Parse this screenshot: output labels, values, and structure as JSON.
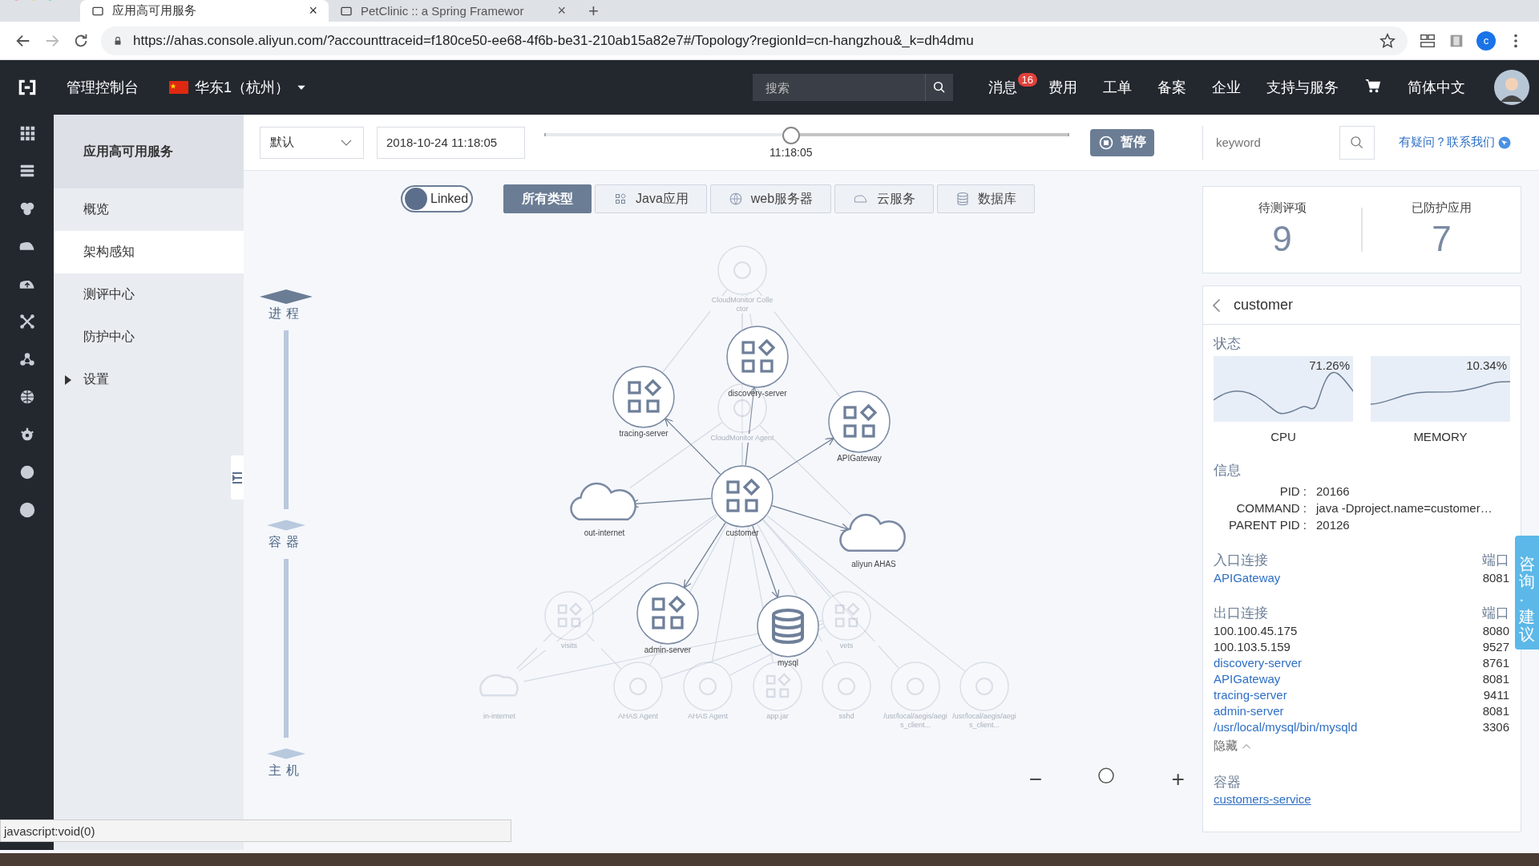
{
  "browser": {
    "tabs": [
      {
        "title": "应用高可用服务",
        "selected": true,
        "close": "×"
      },
      {
        "title": "PetClinic :: a Spring Framewor",
        "selected": false,
        "close": "×"
      }
    ],
    "new_tab": "+",
    "url": "https://ahas.console.aliyun.com/?accounttraceid=f180ce50-ee68-4f6b-be31-210ab15a82e7#/Topology?regionId=cn-hangzhou&_k=dh4dmu",
    "profile": "c"
  },
  "header": {
    "console": "管理控制台",
    "region": "华东1（杭州）",
    "search_placeholder": "搜索",
    "nav": [
      {
        "label": "消息",
        "badge": "16"
      },
      {
        "label": "费用"
      },
      {
        "label": "工单"
      },
      {
        "label": "备案"
      },
      {
        "label": "企业"
      },
      {
        "label": "支持与服务"
      }
    ],
    "language": "简体中文"
  },
  "sidebar": {
    "title": "应用高可用服务",
    "items": [
      {
        "label": "概览",
        "selected": false,
        "kind": "link"
      },
      {
        "label": "架构感知",
        "selected": true,
        "kind": "link"
      },
      {
        "label": "测评中心",
        "selected": false,
        "kind": "link"
      },
      {
        "label": "防护中心",
        "selected": false,
        "kind": "link"
      },
      {
        "label": "设置",
        "selected": false,
        "kind": "group"
      }
    ]
  },
  "toolbar": {
    "view": "默认",
    "time": "2018-10-24 11:18:05",
    "timeline": {
      "level": 0.47,
      "label": "11:18:05"
    },
    "pause": "暂停",
    "keyword_placeholder": "keyword",
    "help": "有疑问？联系我们"
  },
  "layers": [
    "进程",
    "容器",
    "主机"
  ],
  "linked": {
    "label": "Linked",
    "on": true
  },
  "type_filters": [
    {
      "label": "所有类型",
      "selected": true,
      "kind": "all"
    },
    {
      "label": "Java应用",
      "selected": false,
      "kind": "app"
    },
    {
      "label": "web服务器",
      "selected": false,
      "kind": "web"
    },
    {
      "label": "云服务",
      "selected": false,
      "kind": "cloud"
    },
    {
      "label": "数据库",
      "selected": false,
      "kind": "db"
    }
  ],
  "topology": {
    "nodes": [
      {
        "label": "CloudMonitor Collector",
        "kind": "agent",
        "faded": true
      },
      {
        "label": "discovery-server",
        "kind": "app",
        "faded": false
      },
      {
        "label": "tracing-server",
        "kind": "app",
        "faded": false
      },
      {
        "label": "CloudMonitor Agent",
        "kind": "agent",
        "faded": true
      },
      {
        "label": "APIGateway",
        "kind": "app",
        "faded": false
      },
      {
        "label": "customer",
        "kind": "app",
        "faded": false
      },
      {
        "label": "out-internet",
        "kind": "cloud",
        "faded": false
      },
      {
        "label": "aliyun AHAS",
        "kind": "cloud",
        "faded": false
      },
      {
        "label": "admin-server",
        "kind": "app",
        "faded": false
      },
      {
        "label": "visits",
        "kind": "app",
        "faded": true
      },
      {
        "label": "vets",
        "kind": "app",
        "faded": true
      },
      {
        "label": "mysql",
        "kind": "db",
        "faded": false
      },
      {
        "label": "in-internet",
        "kind": "cloud",
        "faded": true
      },
      {
        "label": "AHAS Agent",
        "kind": "agent",
        "faded": true
      },
      {
        "label": "AHAS Agent",
        "kind": "agent",
        "faded": true
      },
      {
        "label": "app.jar",
        "kind": "app",
        "faded": true
      },
      {
        "label": "sshd",
        "kind": "agent",
        "faded": true
      },
      {
        "label": "/usr/local/aegis/aegis_client...",
        "kind": "agent",
        "faded": true
      },
      {
        "label": "/usr/local/aegis/aegis_client...",
        "kind": "agent",
        "faded": true
      }
    ],
    "zoom": {
      "minus": "−",
      "plus": "+"
    }
  },
  "stats": [
    {
      "label": "待测评项",
      "value": "9"
    },
    {
      "label": "已防护应用",
      "value": "7"
    }
  ],
  "detail": {
    "title": "customer",
    "status_heading": "状态",
    "metrics": [
      {
        "name": "CPU",
        "reading": "71.26%"
      },
      {
        "name": "MEMORY",
        "reading": "10.34%"
      }
    ],
    "info_heading": "信息",
    "info": [
      {
        "key": "PID :",
        "value": "20166"
      },
      {
        "key": "COMMAND :",
        "value": "java -Dproject.name=customer…"
      },
      {
        "key": "PARENT PID :",
        "value": "20126"
      }
    ],
    "inbound": {
      "heading": "入口连接",
      "port_heading": "端口",
      "rows": [
        {
          "target": "APIGateway",
          "port": "8081",
          "kind": "link"
        }
      ]
    },
    "outbound": {
      "heading": "出口连接",
      "port_heading": "端口",
      "rows": [
        {
          "target": "100.100.45.175",
          "port": "8080",
          "kind": "plain"
        },
        {
          "target": "100.103.5.159",
          "port": "9527",
          "kind": "plain"
        },
        {
          "target": "discovery-server",
          "port": "8761",
          "kind": "link"
        },
        {
          "target": "APIGateway",
          "port": "8081",
          "kind": "link"
        },
        {
          "target": "tracing-server",
          "port": "9411",
          "kind": "link"
        },
        {
          "target": "admin-server",
          "port": "8081",
          "kind": "link"
        },
        {
          "target": "/usr/local/mysql/bin/mysqld",
          "port": "3306",
          "kind": "link"
        }
      ]
    },
    "hide": "隐藏",
    "container_heading": "容器",
    "container": "customers-service"
  },
  "feedback": "咨询·建议",
  "status_url": "javascript:void(0)"
}
